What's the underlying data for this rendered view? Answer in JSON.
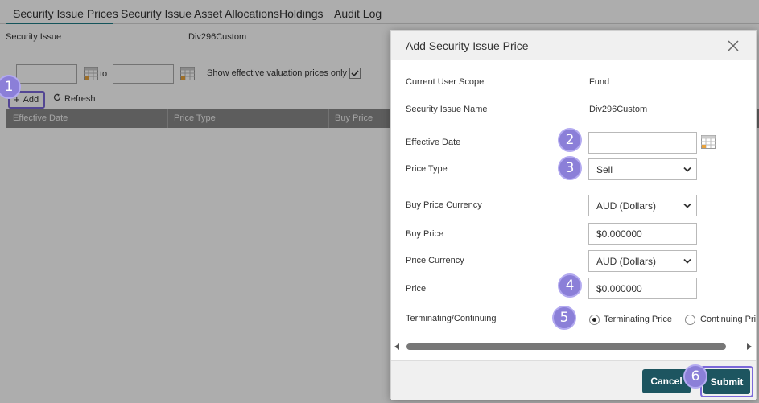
{
  "tabs": [
    {
      "label": "Security Issue Prices",
      "active": true
    },
    {
      "label": "Security Issue Asset Allocations"
    },
    {
      "label": "Holdings"
    },
    {
      "label": "Audit Log"
    }
  ],
  "filter": {
    "security_issue_label": "Security Issue",
    "security_issue_value": "Div296Custom",
    "to_label": "to",
    "show_effective_label": "Show effective valuation prices only",
    "show_effective_checked": true
  },
  "toolbar": {
    "add_label": "Add",
    "refresh_label": "Refresh"
  },
  "grid": {
    "columns": [
      "Effective Date",
      "Price Type",
      "Buy Price"
    ]
  },
  "steps": [
    "1",
    "2",
    "3",
    "4",
    "5",
    "6"
  ],
  "dialog": {
    "title": "Add Security Issue Price",
    "current_user_scope_label": "Current User Scope",
    "current_user_scope_value": "Fund",
    "security_issue_name_label": "Security Issue Name",
    "security_issue_name_value": "Div296Custom",
    "effective_date_label": "Effective Date",
    "effective_date_value": "",
    "price_type_label": "Price Type",
    "price_type_value": "Sell",
    "buy_price_currency_label": "Buy Price Currency",
    "buy_price_currency_value": "AUD (Dollars)",
    "buy_price_label": "Buy Price",
    "buy_price_value": "$0.000000",
    "price_currency_label": "Price Currency",
    "price_currency_value": "AUD (Dollars)",
    "price_label": "Price",
    "price_value": "$0.000000",
    "terminating_label": "Terminating/Continuing",
    "terminating_option": "Terminating Price",
    "continuing_option": "Continuing Pri",
    "selected_option": "Terminating Price",
    "cancel_label": "Cancel",
    "submit_label": "Submit"
  },
  "colors": {
    "accent": "#1e7d86",
    "button": "#1d5560",
    "highlight": "#7b68d9",
    "badge": "#8b7fd8"
  }
}
